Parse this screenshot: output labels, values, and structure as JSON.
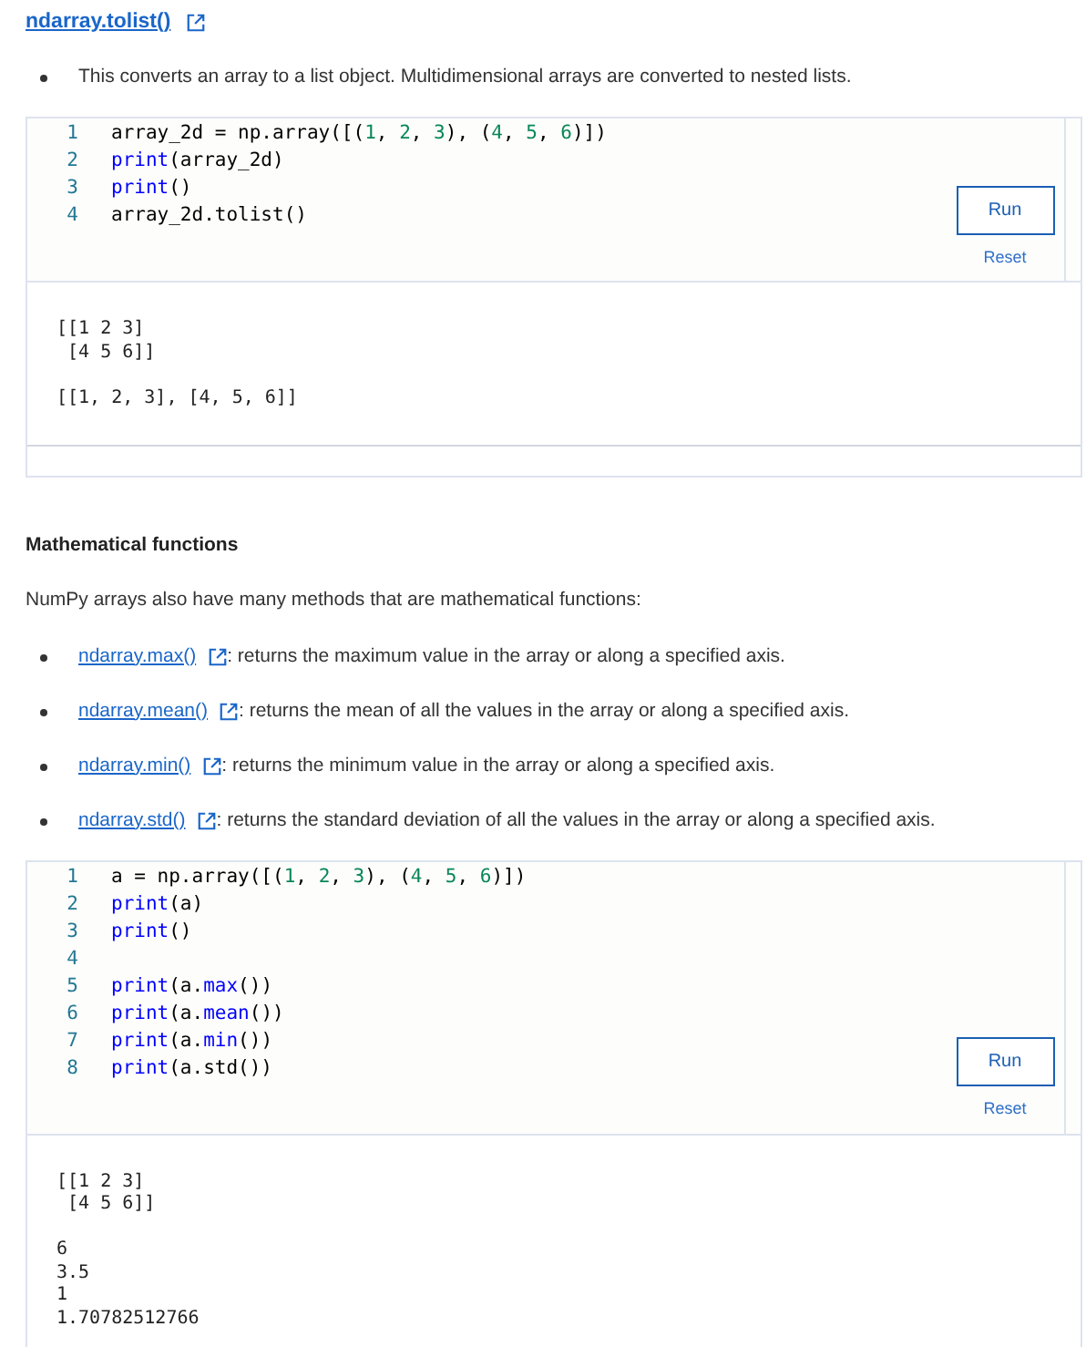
{
  "title_link": {
    "text": "ndarray.tolist()"
  },
  "intro_bullets": [
    "This converts an array to a list object. Multidimensional arrays are converted to nested lists."
  ],
  "examples": [
    {
      "code": [
        {
          "number": "1",
          "tokens": [
            {
              "text": "array_2d = np.array([(",
              "kind": "plain"
            },
            {
              "text": "1",
              "kind": "number"
            },
            {
              "text": ", ",
              "kind": "plain"
            },
            {
              "text": "2",
              "kind": "number"
            },
            {
              "text": ", ",
              "kind": "plain"
            },
            {
              "text": "3",
              "kind": "number"
            },
            {
              "text": "), (",
              "kind": "plain"
            },
            {
              "text": "4",
              "kind": "number"
            },
            {
              "text": ", ",
              "kind": "plain"
            },
            {
              "text": "5",
              "kind": "number"
            },
            {
              "text": ", ",
              "kind": "plain"
            },
            {
              "text": "6",
              "kind": "number"
            },
            {
              "text": ")])",
              "kind": "plain"
            }
          ]
        },
        {
          "number": "2",
          "tokens": [
            {
              "text": "print",
              "kind": "keyword"
            },
            {
              "text": "(array_2d)",
              "kind": "plain"
            }
          ]
        },
        {
          "number": "3",
          "tokens": [
            {
              "text": "print",
              "kind": "keyword"
            },
            {
              "text": "()",
              "kind": "plain"
            }
          ]
        },
        {
          "number": "4",
          "tokens": [
            {
              "text": "array_2d.tolist()",
              "kind": "plain"
            }
          ]
        }
      ],
      "run_button": "Run",
      "reset_link": "Reset",
      "output": "[[1 2 3]\n [4 5 6]]\n\n[[1, 2, 3], [4, 5, 6]]"
    }
  ],
  "section": {
    "heading": "Mathematical functions",
    "paragraph": "NumPy arrays also have many methods that are mathematical functions:",
    "bullets": [
      {
        "link": "ndarray.max()",
        "text": ": returns the maximum value in the array or along a specified axis."
      },
      {
        "link": "ndarray.mean()",
        "text": ": returns the mean of all the values in the array or along a specified axis."
      },
      {
        "link": "ndarray.min()",
        "text": ": returns the minimum value in the array or along a specified axis."
      },
      {
        "link": "ndarray.std()",
        "text": ": returns the standard deviation of all the values in the array or along a specified axis."
      }
    ],
    "example": {
      "code": [
        {
          "number": "1",
          "tokens": [
            {
              "text": "a = np.array([(",
              "kind": "plain"
            },
            {
              "text": "1",
              "kind": "number"
            },
            {
              "text": ", ",
              "kind": "plain"
            },
            {
              "text": "2",
              "kind": "number"
            },
            {
              "text": ", ",
              "kind": "plain"
            },
            {
              "text": "3",
              "kind": "number"
            },
            {
              "text": "), (",
              "kind": "plain"
            },
            {
              "text": "4",
              "kind": "number"
            },
            {
              "text": ", ",
              "kind": "plain"
            },
            {
              "text": "5",
              "kind": "number"
            },
            {
              "text": ", ",
              "kind": "plain"
            },
            {
              "text": "6",
              "kind": "number"
            },
            {
              "text": ")])",
              "kind": "plain"
            }
          ]
        },
        {
          "number": "2",
          "tokens": [
            {
              "text": "print",
              "kind": "keyword"
            },
            {
              "text": "(a)",
              "kind": "plain"
            }
          ]
        },
        {
          "number": "3",
          "tokens": [
            {
              "text": "print",
              "kind": "keyword"
            },
            {
              "text": "()",
              "kind": "plain"
            }
          ]
        },
        {
          "number": "4"
        },
        {
          "number": "5",
          "tokens": [
            {
              "text": "print",
              "kind": "keyword"
            },
            {
              "text": "(a.",
              "kind": "plain"
            },
            {
              "text": "max",
              "kind": "keyword"
            },
            {
              "text": "())",
              "kind": "plain"
            }
          ]
        },
        {
          "number": "6",
          "tokens": [
            {
              "text": "print",
              "kind": "keyword"
            },
            {
              "text": "(a.",
              "kind": "plain"
            },
            {
              "text": "mean",
              "kind": "keyword"
            },
            {
              "text": "())",
              "kind": "plain"
            }
          ]
        },
        {
          "number": "7",
          "tokens": [
            {
              "text": "print",
              "kind": "keyword"
            },
            {
              "text": "(a.",
              "kind": "plain"
            },
            {
              "text": "min",
              "kind": "keyword"
            },
            {
              "text": "())",
              "kind": "plain"
            }
          ]
        },
        {
          "number": "8",
          "tokens": [
            {
              "text": "print",
              "kind": "keyword"
            },
            {
              "text": "(a.std())",
              "kind": "plain"
            }
          ]
        }
      ],
      "run_button": "Run",
      "reset_link": "Reset",
      "output": "[[1 2 3]\n [4 5 6]]\n\n6\n3.5\n1\n1.70782512766"
    }
  }
}
